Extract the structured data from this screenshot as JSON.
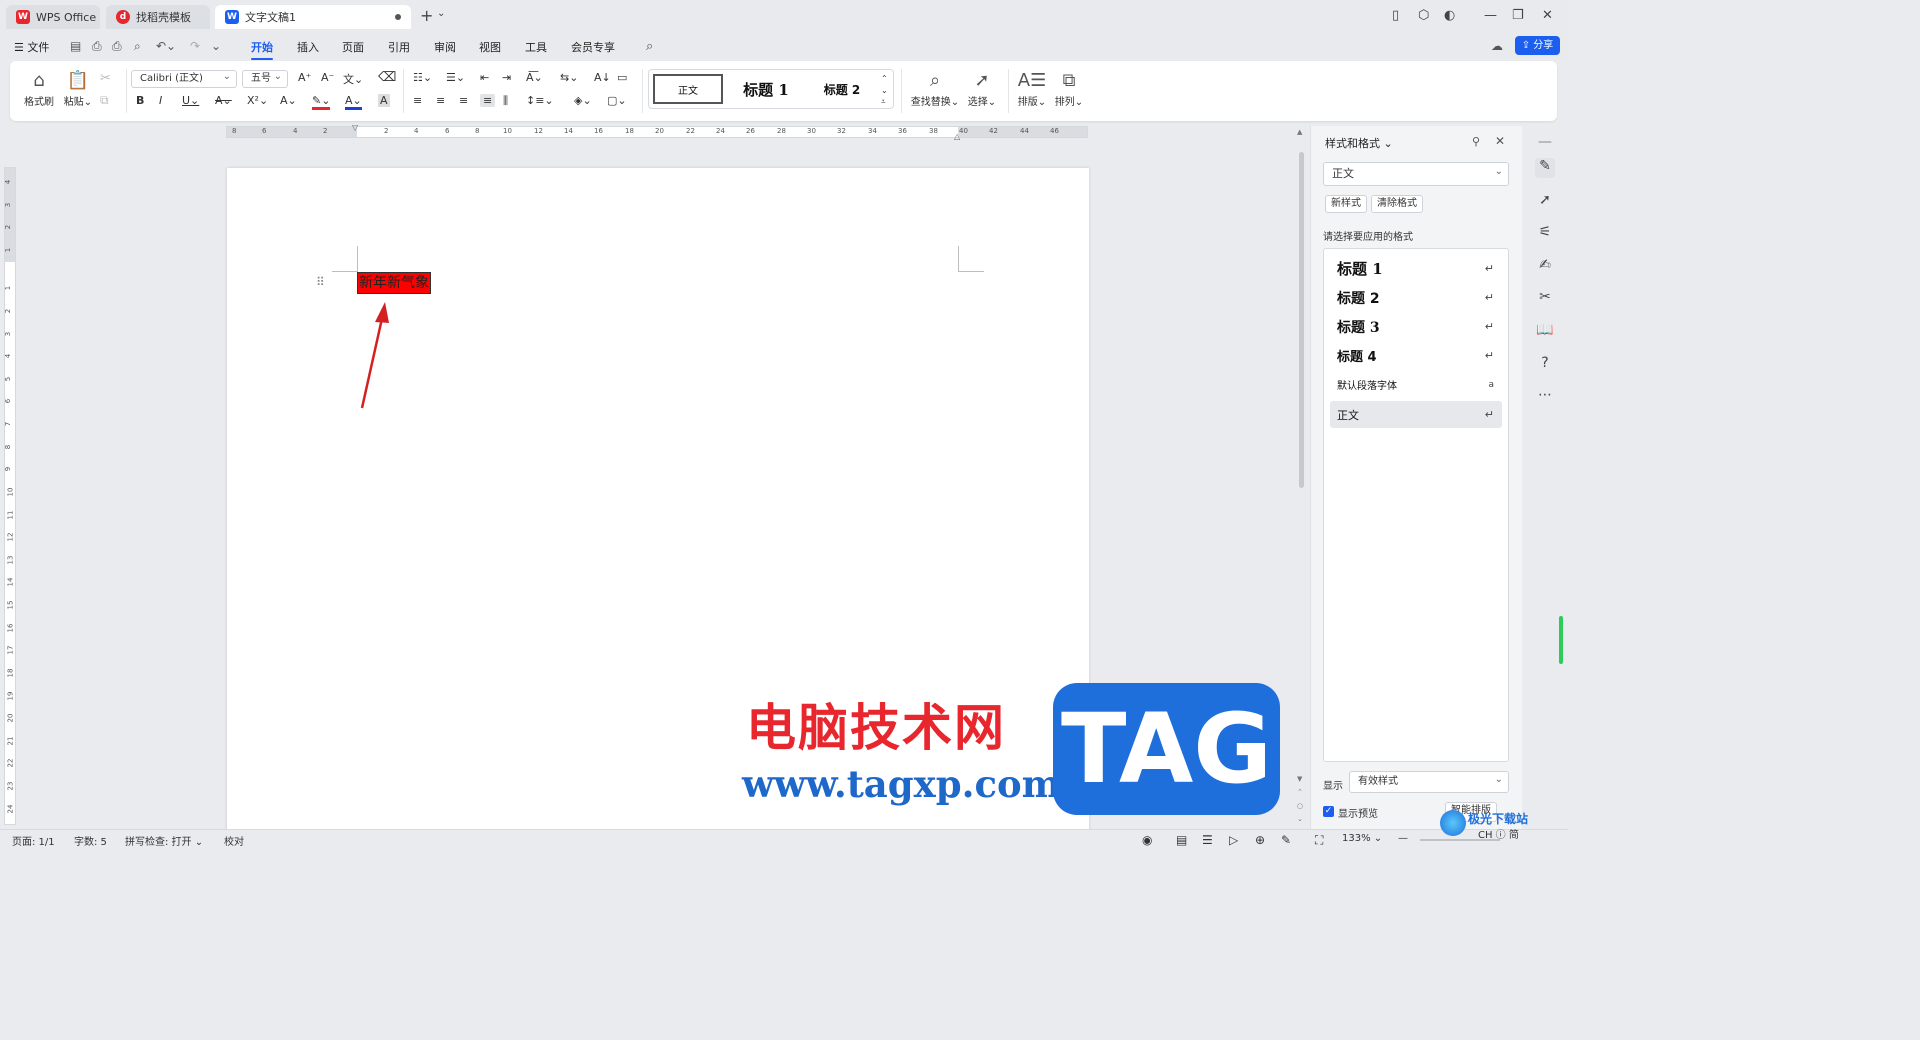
{
  "titlebar": {
    "tabs": [
      {
        "label": "WPS Office",
        "icon": "wps-logo-icon"
      },
      {
        "label": "找稻壳模板",
        "icon": "docer-icon"
      },
      {
        "label": "文字文稿1",
        "icon": "writer-doc-icon"
      }
    ],
    "new_tab": "+"
  },
  "menubar": {
    "file_label": "文件",
    "tabs": [
      "开始",
      "插入",
      "页面",
      "引用",
      "审阅",
      "视图",
      "工具",
      "会员专享"
    ],
    "active_tab": "开始",
    "share_label": "分享"
  },
  "ribbon": {
    "format_painter": "格式刷",
    "paste": "粘贴",
    "font_name": "Calibri (正文)",
    "font_size": "五号",
    "styles": [
      "正文",
      "标题 1",
      "标题 2"
    ],
    "find_replace": "查找替换",
    "select": "选择",
    "layout": "排版",
    "arrange": "排列"
  },
  "ruler": {
    "h_ticks": [
      "8",
      "6",
      "4",
      "2",
      "2",
      "4",
      "6",
      "8",
      "10",
      "12",
      "14",
      "16",
      "18",
      "20",
      "22",
      "24",
      "26",
      "28",
      "30",
      "32",
      "34",
      "36",
      "38",
      "40",
      "42",
      "44",
      "46"
    ],
    "v_ticks": [
      "4",
      "3",
      "2",
      "1",
      "1",
      "2",
      "3",
      "4",
      "5",
      "6",
      "7",
      "8",
      "9",
      "10",
      "11",
      "12",
      "13",
      "14",
      "15",
      "16",
      "17",
      "18",
      "19",
      "20",
      "21",
      "22",
      "23",
      "24"
    ]
  },
  "document": {
    "text": "新年新气象",
    "highlight_color": "#ff0000"
  },
  "panel": {
    "title": "样式和格式",
    "current_style": "正文",
    "new_style": "新样式",
    "clear_format": "清除格式",
    "prompt": "请选择要应用的格式",
    "styles": [
      {
        "label": "标题  1"
      },
      {
        "label": "标题  2"
      },
      {
        "label": "标题  3"
      },
      {
        "label": "标题  4"
      },
      {
        "label": "默认段落字体"
      },
      {
        "label": "正文"
      }
    ],
    "selected_style": "正文",
    "show_label": "显示",
    "show_value": "有效样式",
    "preview_label": "显示预览",
    "preview_checked": true,
    "smart_layout": "智能排版"
  },
  "statusbar": {
    "page": "页面: 1/1",
    "word_count": "字数: 5",
    "spell_check": "拼写检查: 打开",
    "proofread": "校对",
    "zoom": "133%"
  },
  "watermark": {
    "cn": "电脑技术网",
    "url": "www.tagxp.com",
    "tag": "TAG",
    "xz_line1": "极光下载站",
    "xz_line2": "CH ⓘ 简"
  },
  "colors": {
    "accent": "#1c5ff0",
    "wps_red": "#e8262d",
    "tag_blue": "#1e6fdc"
  }
}
